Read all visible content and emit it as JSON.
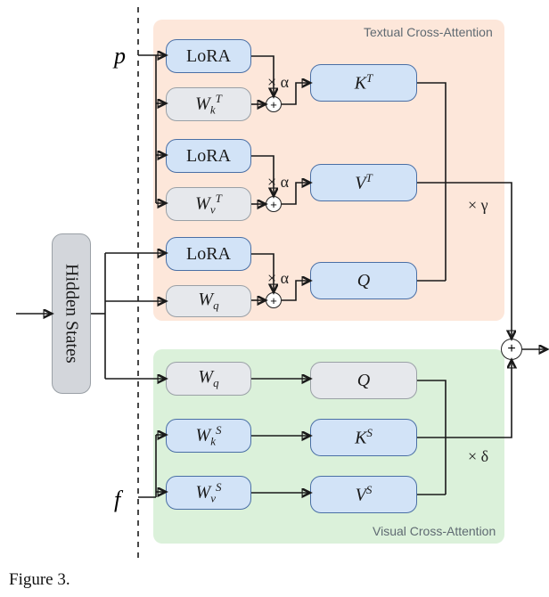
{
  "inputs": {
    "p": "p",
    "f": "f"
  },
  "hidden_states": "Hidden States",
  "regions": {
    "textual": {
      "label": "Textual Cross-Attention"
    },
    "visual": {
      "label": "Visual Cross-Attention"
    }
  },
  "blocks": {
    "textual": {
      "lora1": "LoRA",
      "wk": "W",
      "wk_sub": "k",
      "wk_sup": "T",
      "lora2": "LoRA",
      "wv": "W",
      "wv_sub": "v",
      "wv_sup": "T",
      "lora3": "LoRA",
      "wq": "W",
      "wq_sub": "q",
      "KT": "K",
      "KT_sup": "T",
      "VT": "V",
      "VT_sup": "T",
      "Q": "Q"
    },
    "visual": {
      "wq": "W",
      "wq_sub": "q",
      "wk": "W",
      "wk_sub": "k",
      "wk_sup": "S",
      "wv": "W",
      "wv_sub": "v",
      "wv_sup": "S",
      "Q": "Q",
      "KS": "K",
      "KS_sup": "S",
      "VS": "V",
      "VS_sup": "S"
    }
  },
  "ops": {
    "plus": "+",
    "alpha": "× α",
    "gamma": "× γ",
    "delta": "× δ"
  },
  "caption": "Figure 3."
}
